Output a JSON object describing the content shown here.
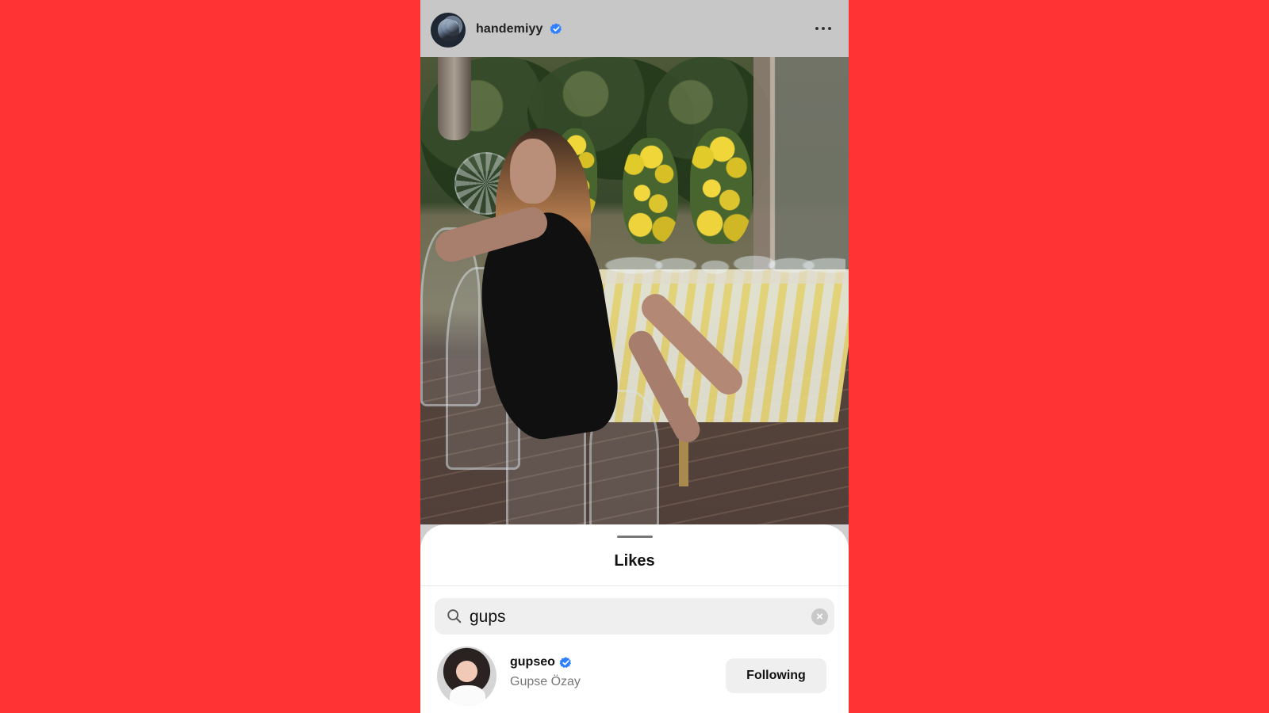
{
  "post": {
    "username": "handemiyy",
    "verified_icon": "verified-badge-icon",
    "more_icon": "more-options-icon"
  },
  "likes_sheet": {
    "title": "Likes",
    "search": {
      "value": "gups",
      "icon": "search-icon",
      "clear_icon": "clear-search-icon",
      "clear_glyph": "×"
    },
    "results": [
      {
        "username": "gupseo",
        "full_name": "Gupse Özay",
        "button_label": "Following",
        "verified_icon": "verified-badge-icon"
      }
    ]
  },
  "colors": {
    "background": "#ff3234",
    "verified": "#2f80ff",
    "sheet": "#ffffff",
    "button": "#efefef"
  }
}
